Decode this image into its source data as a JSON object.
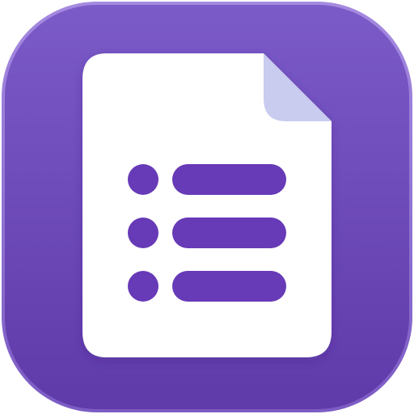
{
  "app_icon": {
    "icon": "google-forms-icon",
    "colors": {
      "tile_top": "#7b5bc8",
      "tile_bottom": "#5f3aa9",
      "tile_rim": "#9a7fd8",
      "page": "#ffffff",
      "page_corner_fold": "#c9ccef",
      "list_marks": "#673ab7"
    },
    "list_rows": 3
  }
}
